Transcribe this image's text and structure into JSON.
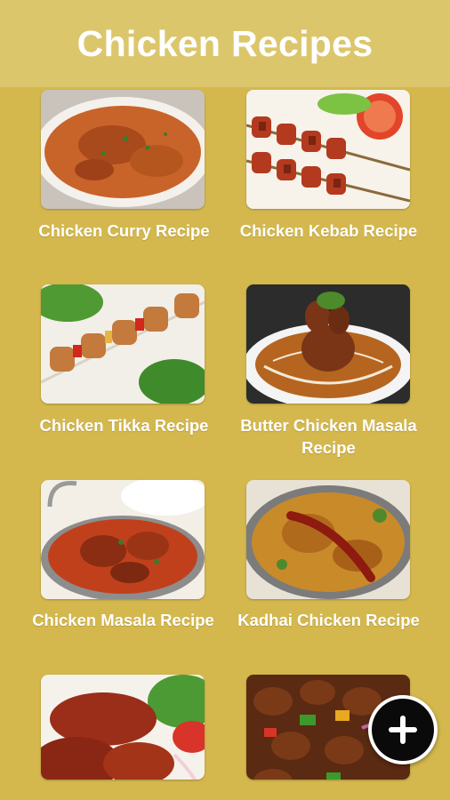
{
  "header": {
    "title": "Chicken Recipes"
  },
  "recipes": [
    {
      "label": "Chicken Curry Recipe",
      "image": "chicken-curry-photo"
    },
    {
      "label": "Chicken Kebab Recipe",
      "image": "chicken-kebab-photo"
    },
    {
      "label": "Chicken Tikka Recipe",
      "image": "chicken-tikka-photo"
    },
    {
      "label": "Butter Chicken Masala Recipe",
      "image": "butter-chicken-photo"
    },
    {
      "label": "Chicken Masala Recipe",
      "image": "chicken-masala-photo"
    },
    {
      "label": "Kadhai Chicken Recipe",
      "image": "kadhai-chicken-photo"
    },
    {
      "label": "",
      "image": "tandoori-chicken-photo"
    },
    {
      "label": "",
      "image": "chilli-chicken-photo"
    }
  ],
  "fab": {
    "icon": "plus-icon"
  },
  "colors": {
    "background": "#d4b84e",
    "header": "#dcc66c",
    "text": "#ffffff",
    "fab": "#0a0a0a"
  }
}
